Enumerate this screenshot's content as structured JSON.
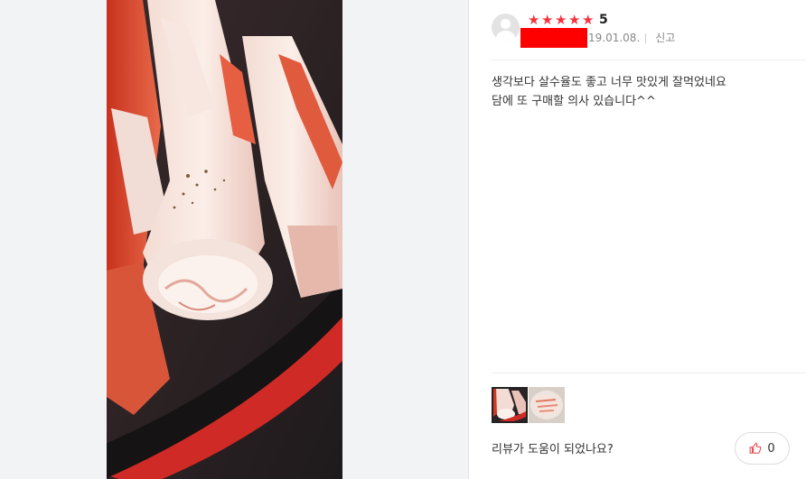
{
  "review": {
    "rating_stars": 5,
    "rating_label": "5",
    "date": "19.01.08.",
    "report_label": "신고",
    "content_lines": [
      "생각보다 살수율도 좋고 너무 맛있게 잘먹었네요",
      "담에 또 구매할 의사 있습니다^^"
    ],
    "helpful_question": "리뷰가 도움이 되었나요?",
    "like_count": "0"
  },
  "colors": {
    "star": "#f5333f",
    "redaction": "#ff0000"
  },
  "thumbnails": [
    {
      "name": "review-photo-thumb-1",
      "active": true
    },
    {
      "name": "review-photo-thumb-2",
      "active": false
    }
  ]
}
